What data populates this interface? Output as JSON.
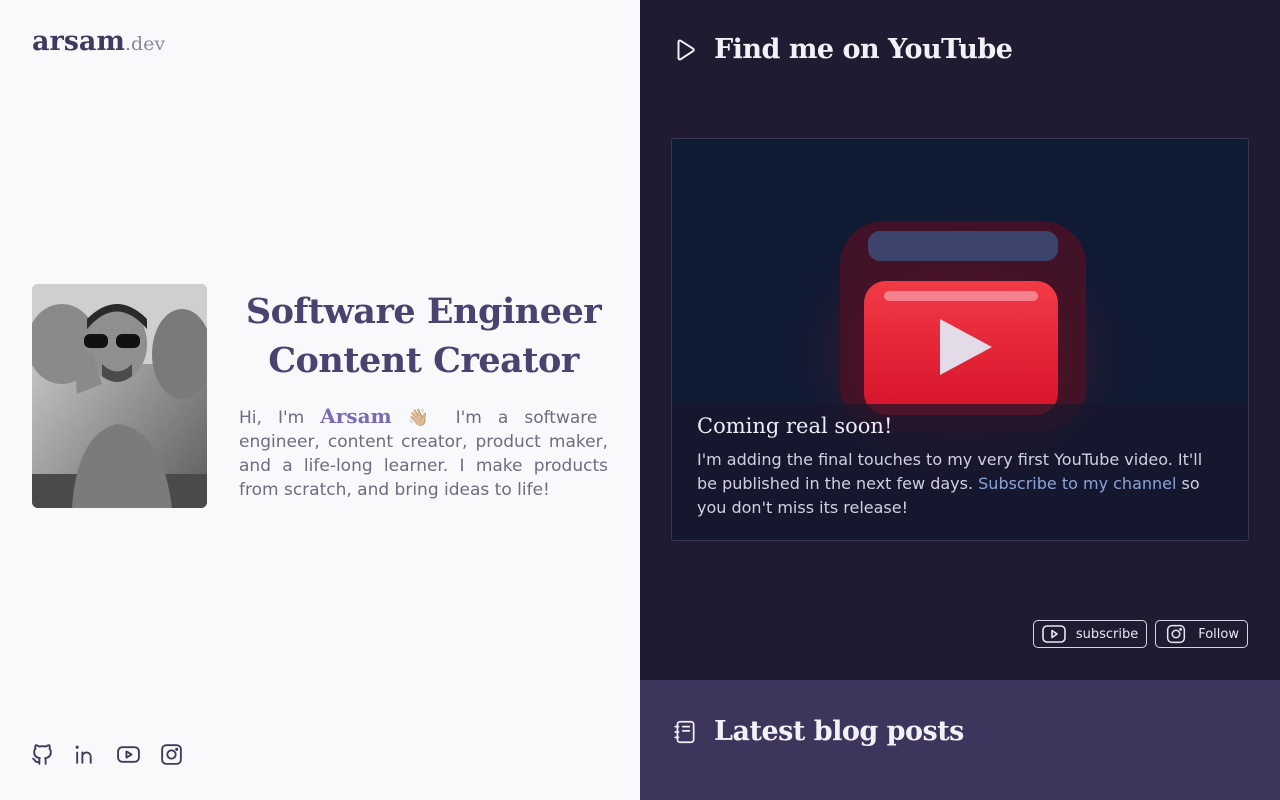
{
  "logo": {
    "name": "arsam",
    "tld": ".dev"
  },
  "hero": {
    "title_line1": "Software Engineer",
    "title_line2": "Content Creator",
    "greeting": "Hi, I'm",
    "name": "Arsam",
    "wave": "👋🏼",
    "intro": "I'm a software engineer, content creator, product maker, and a life-long learner. I make products from scratch, and bring ideas to life!"
  },
  "socials": [
    {
      "icon": "github-icon"
    },
    {
      "icon": "linkedin-icon"
    },
    {
      "icon": "youtube-icon"
    },
    {
      "icon": "instagram-icon"
    }
  ],
  "youtube": {
    "heading": "Find me on YouTube",
    "card_title": "Coming real soon!",
    "card_text_before": "I'm adding the final touches to my very first YouTube video. It'll be published in the next few days.",
    "card_link": "Subscribe to my channel",
    "card_text_after": "so you don't miss its release!",
    "subscribe_label": "subscribe",
    "follow_label": "Follow"
  },
  "blog": {
    "heading": "Latest blog posts"
  },
  "colors": {
    "left_bg": "#f8f9fb",
    "dark_bg": "#201b31",
    "blog_bg": "#3d355c",
    "accent": "#7a6cb4",
    "title": "#4a4370",
    "link": "#8aa4d8"
  }
}
